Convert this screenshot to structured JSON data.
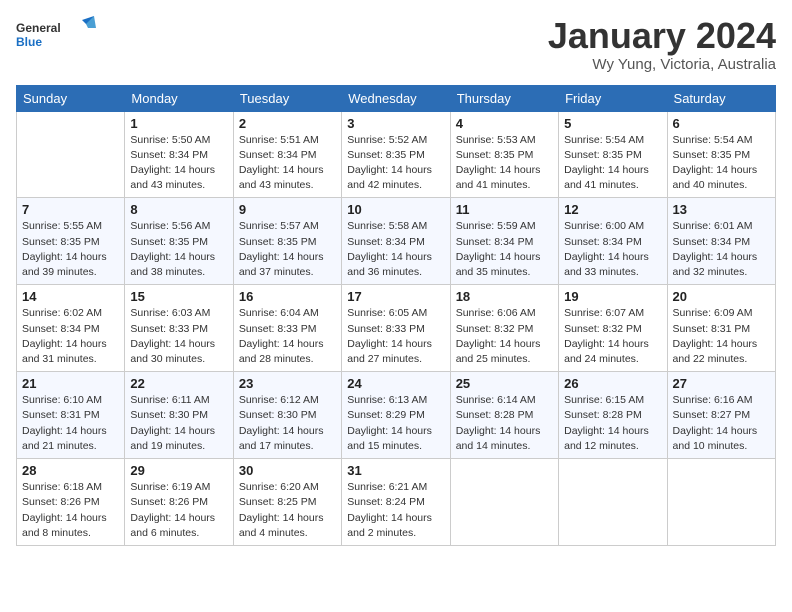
{
  "logo": {
    "line1": "General",
    "line2": "Blue"
  },
  "title": "January 2024",
  "location": "Wy Yung, Victoria, Australia",
  "weekdays": [
    "Sunday",
    "Monday",
    "Tuesday",
    "Wednesday",
    "Thursday",
    "Friday",
    "Saturday"
  ],
  "weeks": [
    [
      {
        "day": "",
        "info": ""
      },
      {
        "day": "1",
        "info": "Sunrise: 5:50 AM\nSunset: 8:34 PM\nDaylight: 14 hours\nand 43 minutes."
      },
      {
        "day": "2",
        "info": "Sunrise: 5:51 AM\nSunset: 8:34 PM\nDaylight: 14 hours\nand 43 minutes."
      },
      {
        "day": "3",
        "info": "Sunrise: 5:52 AM\nSunset: 8:35 PM\nDaylight: 14 hours\nand 42 minutes."
      },
      {
        "day": "4",
        "info": "Sunrise: 5:53 AM\nSunset: 8:35 PM\nDaylight: 14 hours\nand 41 minutes."
      },
      {
        "day": "5",
        "info": "Sunrise: 5:54 AM\nSunset: 8:35 PM\nDaylight: 14 hours\nand 41 minutes."
      },
      {
        "day": "6",
        "info": "Sunrise: 5:54 AM\nSunset: 8:35 PM\nDaylight: 14 hours\nand 40 minutes."
      }
    ],
    [
      {
        "day": "7",
        "info": "Sunrise: 5:55 AM\nSunset: 8:35 PM\nDaylight: 14 hours\nand 39 minutes."
      },
      {
        "day": "8",
        "info": "Sunrise: 5:56 AM\nSunset: 8:35 PM\nDaylight: 14 hours\nand 38 minutes."
      },
      {
        "day": "9",
        "info": "Sunrise: 5:57 AM\nSunset: 8:35 PM\nDaylight: 14 hours\nand 37 minutes."
      },
      {
        "day": "10",
        "info": "Sunrise: 5:58 AM\nSunset: 8:34 PM\nDaylight: 14 hours\nand 36 minutes."
      },
      {
        "day": "11",
        "info": "Sunrise: 5:59 AM\nSunset: 8:34 PM\nDaylight: 14 hours\nand 35 minutes."
      },
      {
        "day": "12",
        "info": "Sunrise: 6:00 AM\nSunset: 8:34 PM\nDaylight: 14 hours\nand 33 minutes."
      },
      {
        "day": "13",
        "info": "Sunrise: 6:01 AM\nSunset: 8:34 PM\nDaylight: 14 hours\nand 32 minutes."
      }
    ],
    [
      {
        "day": "14",
        "info": "Sunrise: 6:02 AM\nSunset: 8:34 PM\nDaylight: 14 hours\nand 31 minutes."
      },
      {
        "day": "15",
        "info": "Sunrise: 6:03 AM\nSunset: 8:33 PM\nDaylight: 14 hours\nand 30 minutes."
      },
      {
        "day": "16",
        "info": "Sunrise: 6:04 AM\nSunset: 8:33 PM\nDaylight: 14 hours\nand 28 minutes."
      },
      {
        "day": "17",
        "info": "Sunrise: 6:05 AM\nSunset: 8:33 PM\nDaylight: 14 hours\nand 27 minutes."
      },
      {
        "day": "18",
        "info": "Sunrise: 6:06 AM\nSunset: 8:32 PM\nDaylight: 14 hours\nand 25 minutes."
      },
      {
        "day": "19",
        "info": "Sunrise: 6:07 AM\nSunset: 8:32 PM\nDaylight: 14 hours\nand 24 minutes."
      },
      {
        "day": "20",
        "info": "Sunrise: 6:09 AM\nSunset: 8:31 PM\nDaylight: 14 hours\nand 22 minutes."
      }
    ],
    [
      {
        "day": "21",
        "info": "Sunrise: 6:10 AM\nSunset: 8:31 PM\nDaylight: 14 hours\nand 21 minutes."
      },
      {
        "day": "22",
        "info": "Sunrise: 6:11 AM\nSunset: 8:30 PM\nDaylight: 14 hours\nand 19 minutes."
      },
      {
        "day": "23",
        "info": "Sunrise: 6:12 AM\nSunset: 8:30 PM\nDaylight: 14 hours\nand 17 minutes."
      },
      {
        "day": "24",
        "info": "Sunrise: 6:13 AM\nSunset: 8:29 PM\nDaylight: 14 hours\nand 15 minutes."
      },
      {
        "day": "25",
        "info": "Sunrise: 6:14 AM\nSunset: 8:28 PM\nDaylight: 14 hours\nand 14 minutes."
      },
      {
        "day": "26",
        "info": "Sunrise: 6:15 AM\nSunset: 8:28 PM\nDaylight: 14 hours\nand 12 minutes."
      },
      {
        "day": "27",
        "info": "Sunrise: 6:16 AM\nSunset: 8:27 PM\nDaylight: 14 hours\nand 10 minutes."
      }
    ],
    [
      {
        "day": "28",
        "info": "Sunrise: 6:18 AM\nSunset: 8:26 PM\nDaylight: 14 hours\nand 8 minutes."
      },
      {
        "day": "29",
        "info": "Sunrise: 6:19 AM\nSunset: 8:26 PM\nDaylight: 14 hours\nand 6 minutes."
      },
      {
        "day": "30",
        "info": "Sunrise: 6:20 AM\nSunset: 8:25 PM\nDaylight: 14 hours\nand 4 minutes."
      },
      {
        "day": "31",
        "info": "Sunrise: 6:21 AM\nSunset: 8:24 PM\nDaylight: 14 hours\nand 2 minutes."
      },
      {
        "day": "",
        "info": ""
      },
      {
        "day": "",
        "info": ""
      },
      {
        "day": "",
        "info": ""
      }
    ]
  ]
}
